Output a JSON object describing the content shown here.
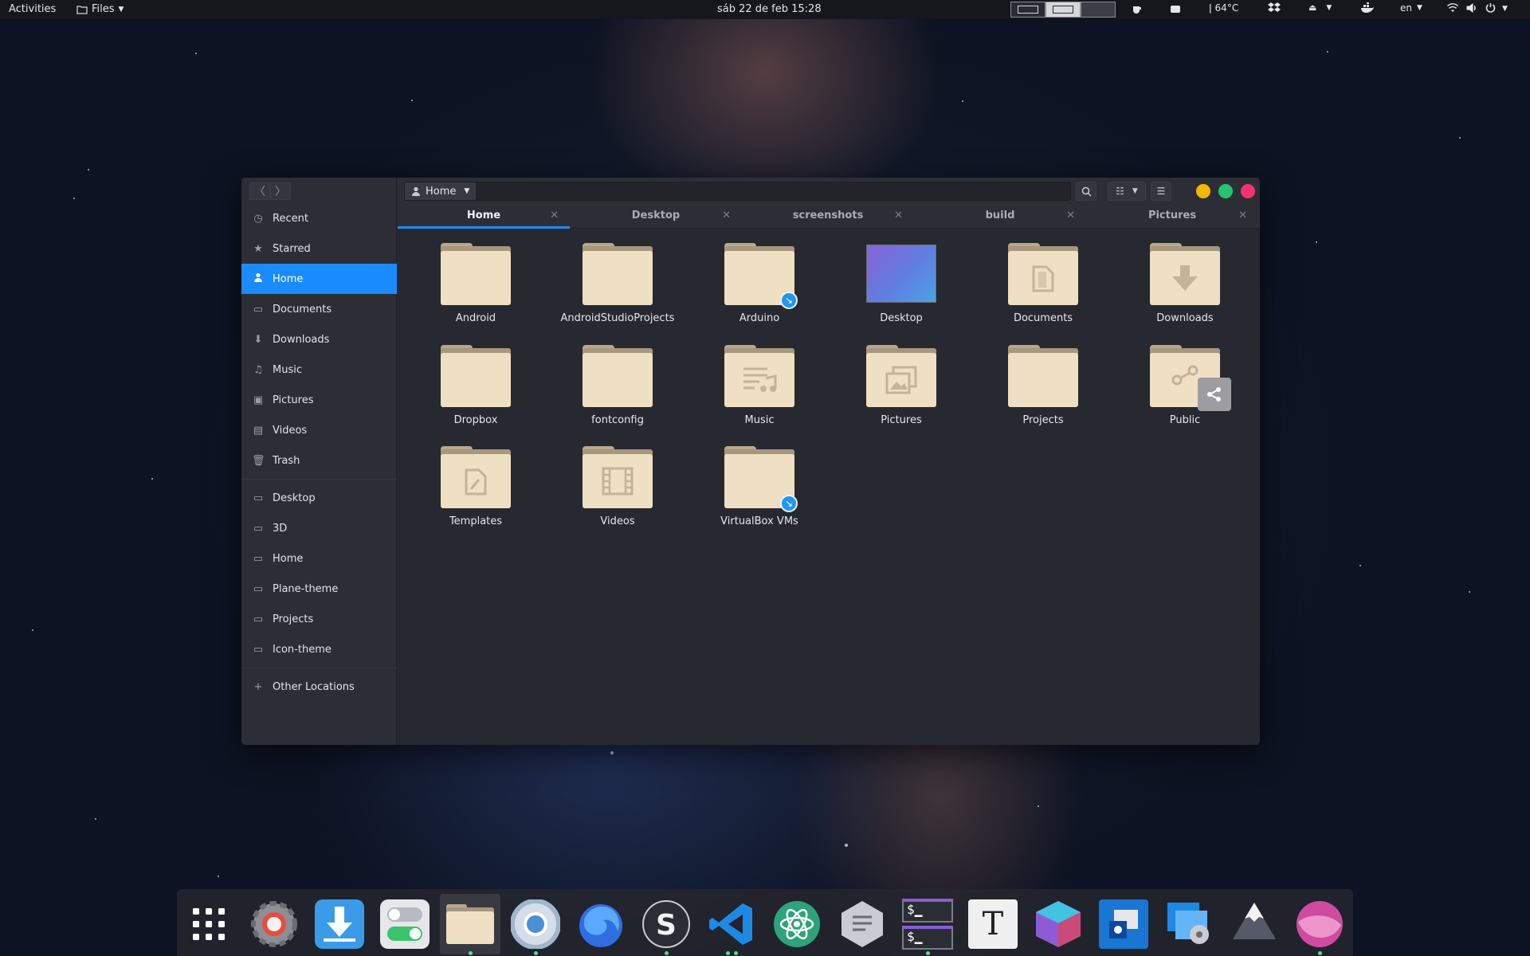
{
  "topbar": {
    "activities": "Activities",
    "app_menu": "Files",
    "clock": "sáb 22 de feb  15:28",
    "temperature": "64°C",
    "language": "en"
  },
  "window": {
    "path": "Home",
    "tabs": [
      {
        "label": "Home",
        "active": true
      },
      {
        "label": "Desktop"
      },
      {
        "label": "screenshots"
      },
      {
        "label": "build"
      },
      {
        "label": "Pictures"
      }
    ],
    "window_buttons_colors": {
      "minimize": "#f7b500",
      "maximize": "#25c56b",
      "close": "#f5336a"
    }
  },
  "sidebar": {
    "places": [
      {
        "label": "Recent",
        "icon": "clock-icon"
      },
      {
        "label": "Starred",
        "icon": "star-icon"
      },
      {
        "label": "Home",
        "icon": "home-icon",
        "active": true
      },
      {
        "label": "Documents",
        "icon": "document-icon"
      },
      {
        "label": "Downloads",
        "icon": "download-icon"
      },
      {
        "label": "Music",
        "icon": "music-icon"
      },
      {
        "label": "Pictures",
        "icon": "pictures-icon"
      },
      {
        "label": "Videos",
        "icon": "videos-icon"
      },
      {
        "label": "Trash",
        "icon": "trash-icon"
      }
    ],
    "bookmarks": [
      {
        "label": "Desktop"
      },
      {
        "label": "3D"
      },
      {
        "label": "Home"
      },
      {
        "label": "Plane-theme"
      },
      {
        "label": "Projects"
      },
      {
        "label": "Icon-theme"
      }
    ],
    "other": "Other Locations"
  },
  "files": [
    {
      "name": "Android"
    },
    {
      "name": "AndroidStudioProjects"
    },
    {
      "name": "Arduino",
      "badge": "link"
    },
    {
      "name": "Desktop",
      "type": "desktop"
    },
    {
      "name": "Documents",
      "glyph": "documents"
    },
    {
      "name": "Downloads",
      "glyph": "downloads"
    },
    {
      "name": "Dropbox"
    },
    {
      "name": "fontconfig"
    },
    {
      "name": "Music",
      "glyph": "music"
    },
    {
      "name": "Pictures",
      "glyph": "pictures"
    },
    {
      "name": "Projects"
    },
    {
      "name": "Public",
      "glyph": "share"
    },
    {
      "name": "Templates",
      "glyph": "templates"
    },
    {
      "name": "Videos",
      "glyph": "videos"
    },
    {
      "name": "VirtualBox VMs",
      "badge": "link"
    }
  ],
  "dock": {
    "apps": [
      {
        "name": "app-grid-icon",
        "color": "#23252c"
      },
      {
        "name": "settings-icon",
        "color": "#8c8f96"
      },
      {
        "name": "software-installer-icon",
        "color": "#3b9be8",
        "running": true
      },
      {
        "name": "tweaks-icon",
        "color": "#c9ccd2"
      },
      {
        "name": "files-icon",
        "color": "#efdfc3",
        "running": true,
        "focused": true
      },
      {
        "name": "chromium-icon",
        "color": "#4a8fd8",
        "running": true
      },
      {
        "name": "firefox-icon",
        "color": "#2e6ee0"
      },
      {
        "name": "sublime-icon",
        "color": "#2b2d34",
        "running": true
      },
      {
        "name": "vscode-icon",
        "color": "#1e88e5",
        "running": true
      },
      {
        "name": "atom-icon",
        "color": "#2ea37a"
      },
      {
        "name": "hexchat-icon",
        "color": "#c9ccd2"
      },
      {
        "name": "terminal-icon",
        "color": "#2b2d34",
        "running": true
      },
      {
        "name": "typora-icon",
        "color": "#f0f0f0"
      },
      {
        "name": "gtk-inspector-icon",
        "color": "#8e5bd6"
      },
      {
        "name": "virtualbox-icon",
        "color": "#1976d2"
      },
      {
        "name": "disk-icon",
        "color": "#1e88e5"
      },
      {
        "name": "inkscape-icon",
        "color": "#555a66"
      },
      {
        "name": "lollypop-icon",
        "color": "#d04aa0",
        "running": true
      }
    ]
  }
}
